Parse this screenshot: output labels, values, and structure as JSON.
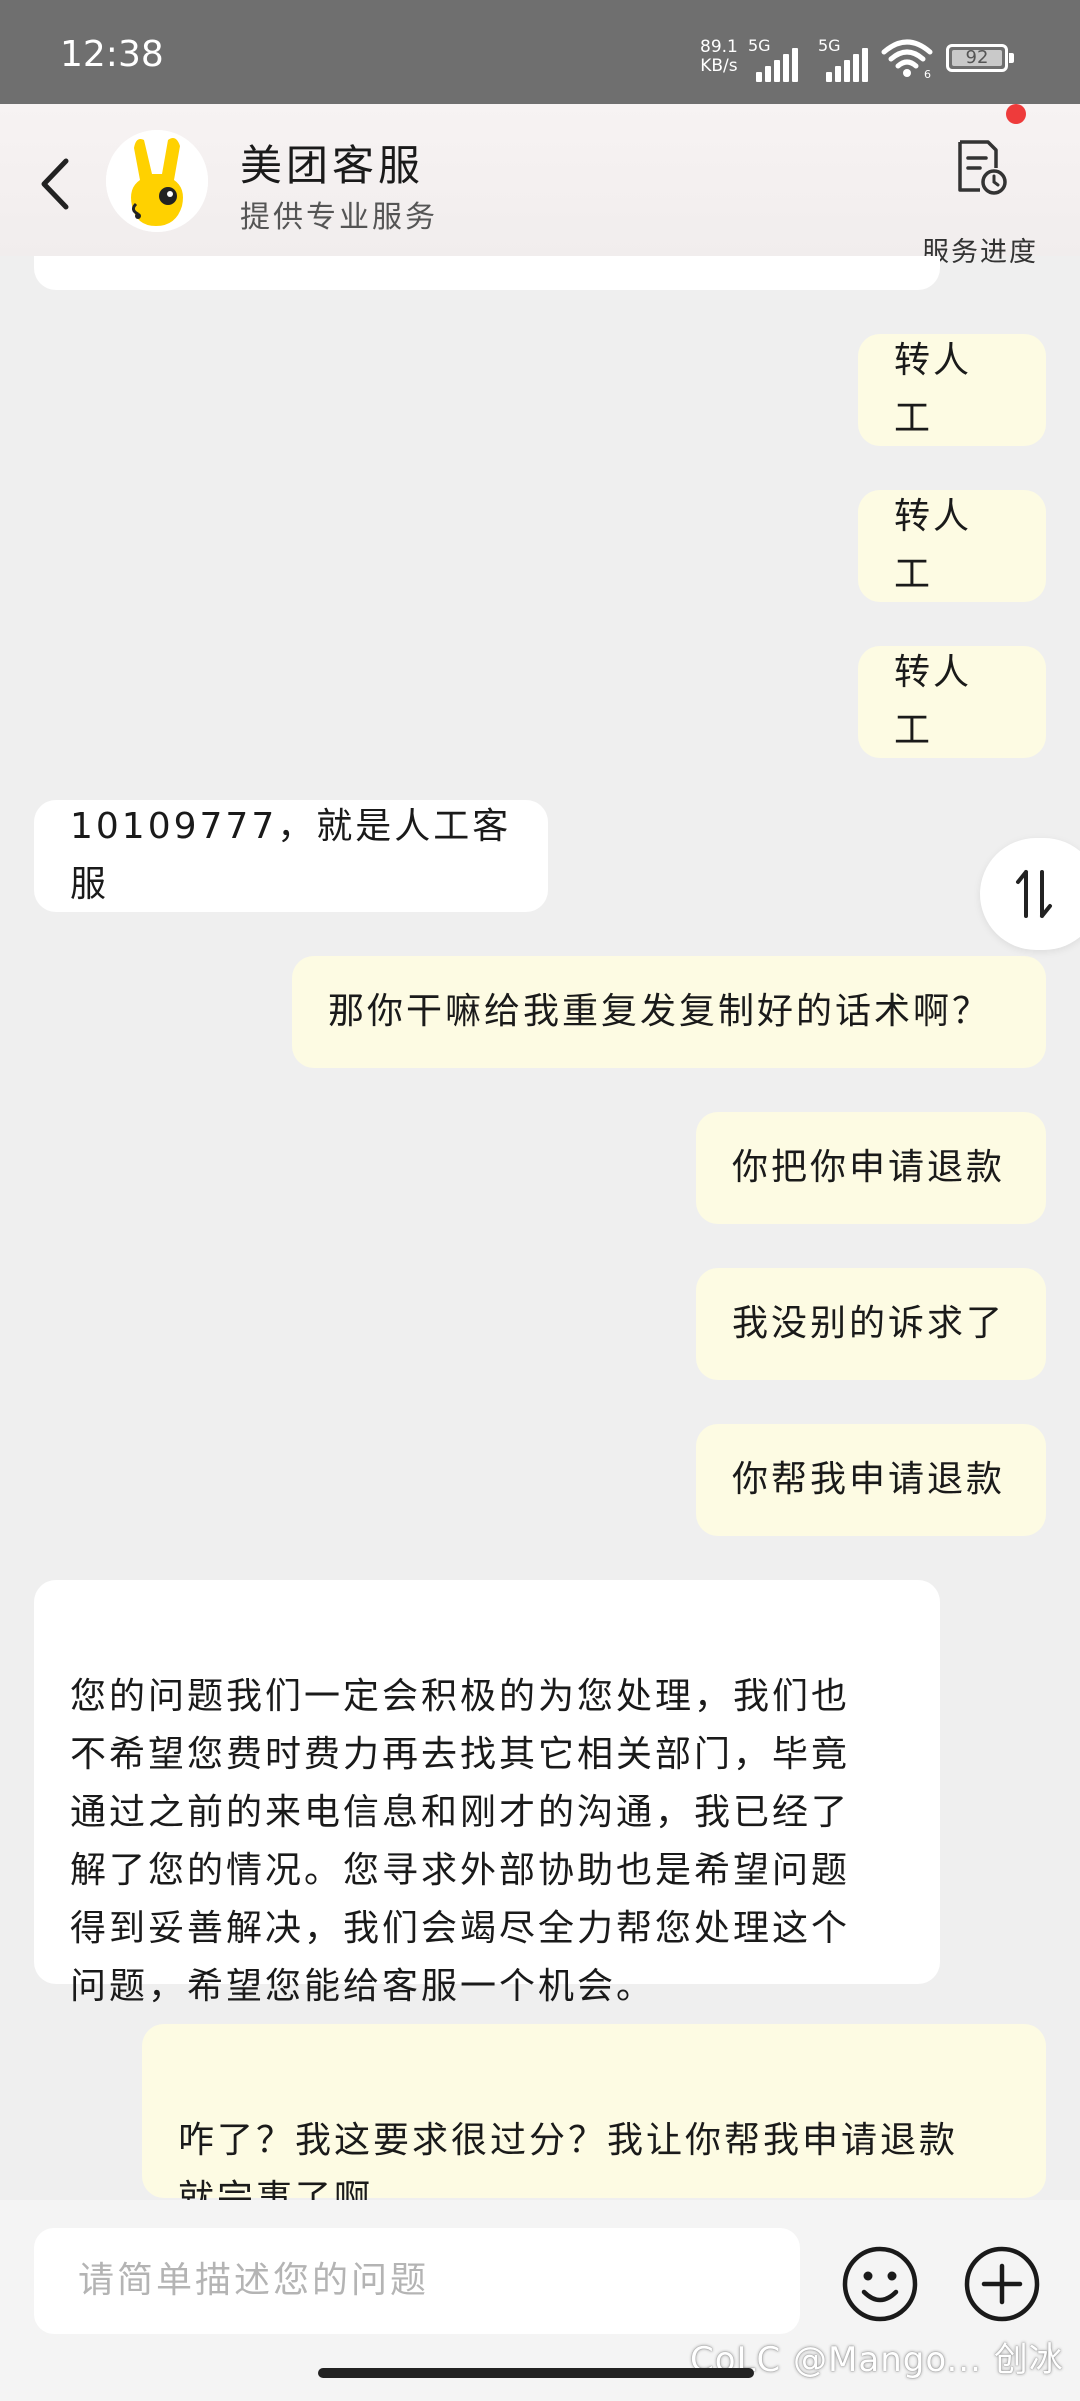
{
  "status_bar": {
    "time": "12:38",
    "net_speed_value": "89.1",
    "net_speed_unit": "KB/s",
    "sim1_label": "5G",
    "sim2_label": "5G",
    "wifi_badge": "6",
    "battery": "92"
  },
  "header": {
    "title": "美团客服",
    "subtitle": "提供专业服务",
    "progress_label": "服务进度"
  },
  "messages": [
    {
      "from": "me",
      "text": "转人工"
    },
    {
      "from": "me",
      "text": "转人工"
    },
    {
      "from": "me",
      "text": "转人工"
    },
    {
      "from": "cs",
      "text": "10109777，就是人工客服"
    },
    {
      "from": "me",
      "text": "那你干嘛给我重复发复制好的话术啊？"
    },
    {
      "from": "me",
      "text": "你把你申请退款"
    },
    {
      "from": "me",
      "text": "我没别的诉求了"
    },
    {
      "from": "me",
      "text": "你帮我申请退款"
    },
    {
      "from": "cs",
      "text": "您的问题我们一定会积极的为您处理，我们也\n不希望您费时费力再去找其它相关部门，毕竟\n通过之前的来电信息和刚才的沟通，我已经了\n解了您的情况。您寻求外部协助也是希望问题\n得到妥善解决，我们会竭尽全力帮您处理这个\n问题，希望您能给客服一个机会。"
    },
    {
      "from": "me",
      "text": "咋了？我这要求很过分？我让你帮我申请退款\n就完事了啊"
    }
  ],
  "input": {
    "placeholder": "请简单描述您的问题"
  },
  "watermark": "CoLC @Mango... 创冰",
  "icons": {
    "back": "chevron-left-icon",
    "progress": "document-clock-icon",
    "scroll": "swap-vertical-icon",
    "emoji": "smiley-icon",
    "plus": "plus-circle-icon"
  },
  "colors": {
    "my_bubble": "#fdfbe3",
    "cs_bubble": "#ffffff",
    "background": "#efefef",
    "notification_dot": "#ee3b3b"
  }
}
